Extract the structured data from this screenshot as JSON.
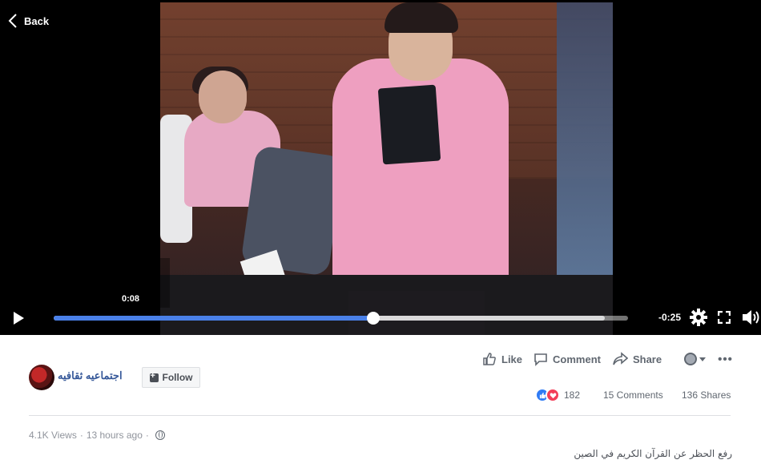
{
  "player": {
    "back_label": "Back",
    "hover_time": "0:08",
    "remaining_time": "-0:25",
    "played_fraction": 0.556,
    "buffered_fraction": 0.96,
    "progress_color": "#4a80e8",
    "icons": {
      "back": "chevron-left-icon",
      "play": "play-icon",
      "settings": "gear-icon",
      "fullscreen": "fullscreen-icon",
      "volume": "volume-icon"
    }
  },
  "page": {
    "name": "اجتماعيه ثقافيه",
    "follow_label": "Follow"
  },
  "actions": {
    "like_label": "Like",
    "comment_label": "Comment",
    "share_label": "Share",
    "more_label": "•••"
  },
  "engagement": {
    "reaction_count": "182",
    "comments": "15 Comments",
    "shares": "136 Shares"
  },
  "meta": {
    "views": "4.1K Views",
    "separator": "·",
    "time": "13 hours ago",
    "separator2": "·"
  },
  "caption": "رفع الحظر عن القرآن الكريم في الصين",
  "colors": {
    "link": "#365899",
    "secondary_text": "#606770",
    "like_blue": "#2f7bf5",
    "love_red": "#f33e58"
  }
}
